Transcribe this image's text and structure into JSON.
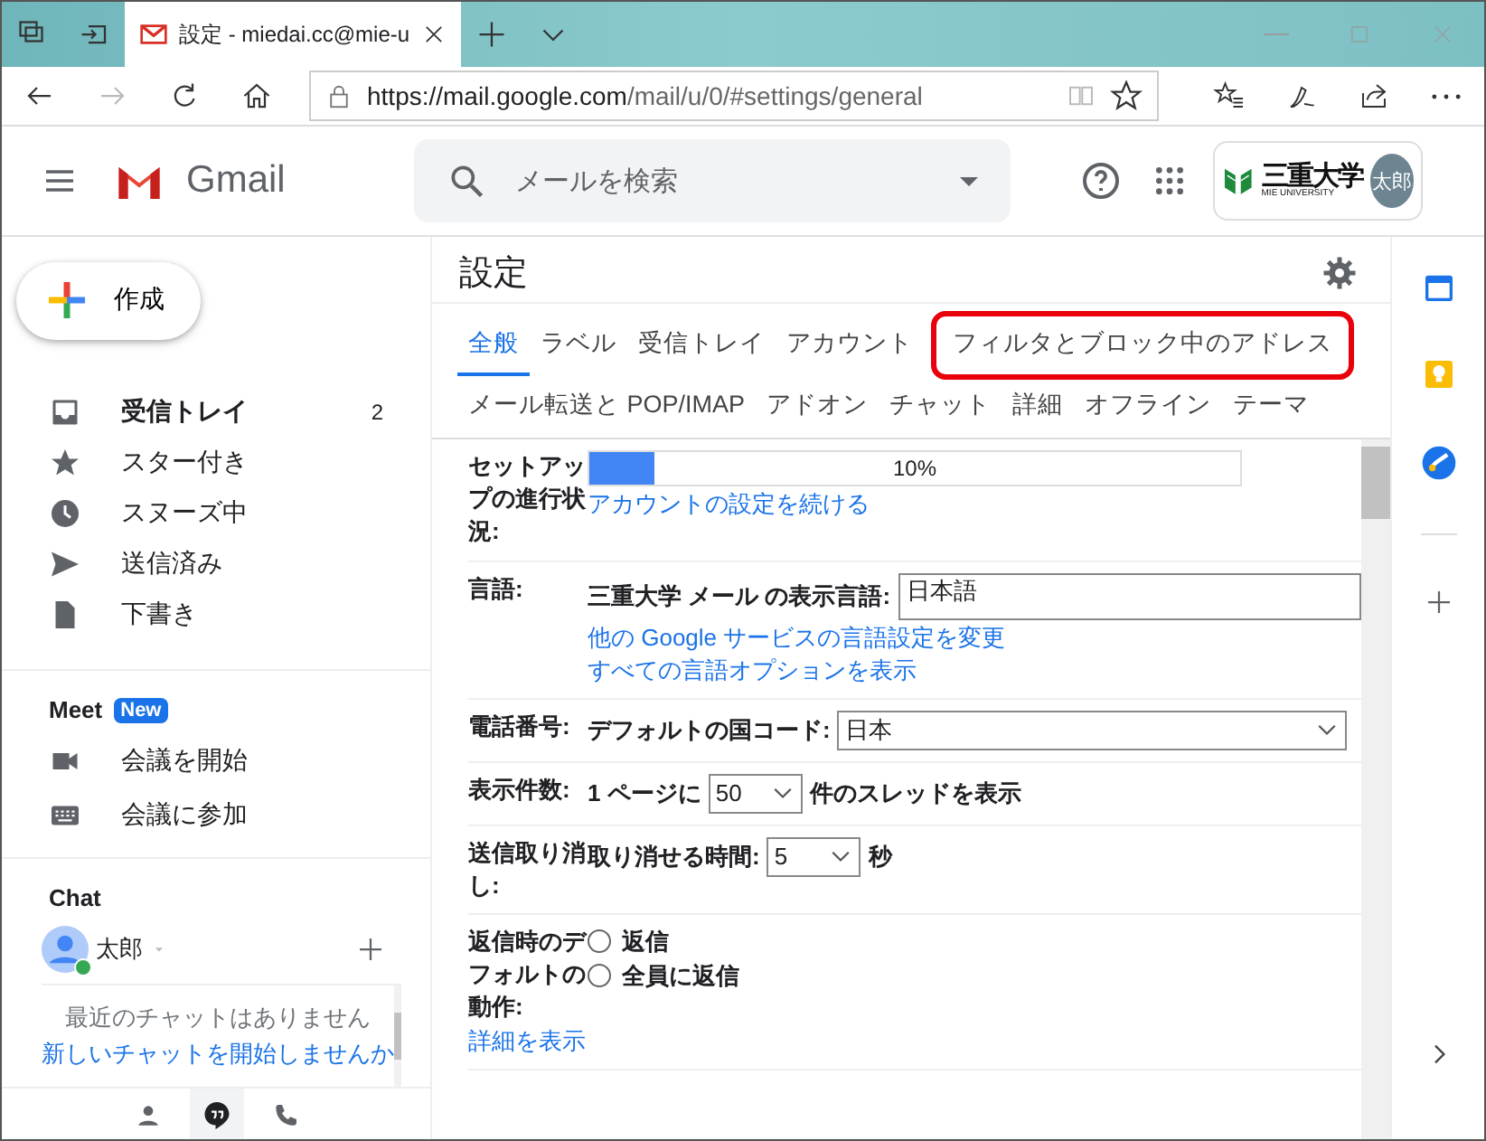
{
  "browser": {
    "tab_title": "設定 - miedai.cc@mie-u",
    "url_host": "https://mail.google.com",
    "url_path": "/mail/u/0/#settings/general"
  },
  "header": {
    "app_name": "Gmail",
    "search_placeholder": "メールを検索",
    "org_name": "三重大学",
    "org_sub": "MIE UNIVERSITY",
    "avatar": "太郎"
  },
  "sidebar": {
    "compose": "作成",
    "folders": [
      {
        "label": "受信トレイ",
        "count": "2",
        "unread": true
      },
      {
        "label": "スター付き",
        "unread": false
      },
      {
        "label": "スヌーズ中",
        "unread": false
      },
      {
        "label": "送信済み",
        "unread": false
      },
      {
        "label": "下書き",
        "unread": false
      }
    ],
    "meet": {
      "title": "Meet",
      "badge": "New",
      "items": [
        {
          "label": "会議を開始"
        },
        {
          "label": "会議に参加"
        }
      ]
    },
    "chat": {
      "title": "Chat",
      "user": "太郎",
      "online": true,
      "empty_text": "最近のチャットはありません",
      "start_link": "新しいチャットを開始しませんか"
    }
  },
  "settings": {
    "title": "設定",
    "tab_rows": [
      [
        {
          "label": "全般",
          "selected": true,
          "highlighted": false
        },
        {
          "label": "ラベル",
          "selected": false,
          "highlighted": false
        },
        {
          "label": "受信トレイ",
          "selected": false,
          "highlighted": false
        },
        {
          "label": "アカウント",
          "selected": false,
          "highlighted": false
        },
        {
          "label": "フィルタとブロック中のアドレス",
          "selected": false,
          "highlighted": true
        }
      ],
      [
        {
          "label": "メール転送と POP/IMAP",
          "selected": false,
          "highlighted": false
        },
        {
          "label": "アドオン",
          "selected": false,
          "highlighted": false
        },
        {
          "label": "チャット",
          "selected": false,
          "highlighted": false
        },
        {
          "label": "詳細",
          "selected": false,
          "highlighted": false
        },
        {
          "label": "オフライン",
          "selected": false,
          "highlighted": false
        },
        {
          "label": "テーマ",
          "selected": false,
          "highlighted": false
        }
      ]
    ],
    "rows": [
      {
        "kind": "progress",
        "label": "セットアップの進行状況:",
        "level": 0.1,
        "reading": "10%",
        "link": "アカウントの設定を続ける"
      },
      {
        "kind": "language",
        "label": "言語:",
        "field_label": "三重大学 メール の表示言語:",
        "value": "日本語",
        "links": [
          "他の Google サービスの言語設定を変更",
          "すべての言語オプションを表示"
        ]
      },
      {
        "kind": "wide_select",
        "label": "電話番号:",
        "before": "デフォルトの国コード:",
        "value": "日本"
      },
      {
        "kind": "select",
        "label": "表示件数:",
        "before": "1 ページに",
        "value": "50",
        "after": "件のスレッドを表示"
      },
      {
        "kind": "select",
        "label": "送信取り消し:",
        "before": "取り消せる時間:",
        "value": "5",
        "after": "秒"
      },
      {
        "kind": "radio",
        "label": "返信時のデフォルトの動作:",
        "options": [
          {
            "label": "返信",
            "selected": false
          },
          {
            "label": "全員に返信",
            "selected": false
          }
        ],
        "link": "詳細を表示"
      }
    ]
  }
}
